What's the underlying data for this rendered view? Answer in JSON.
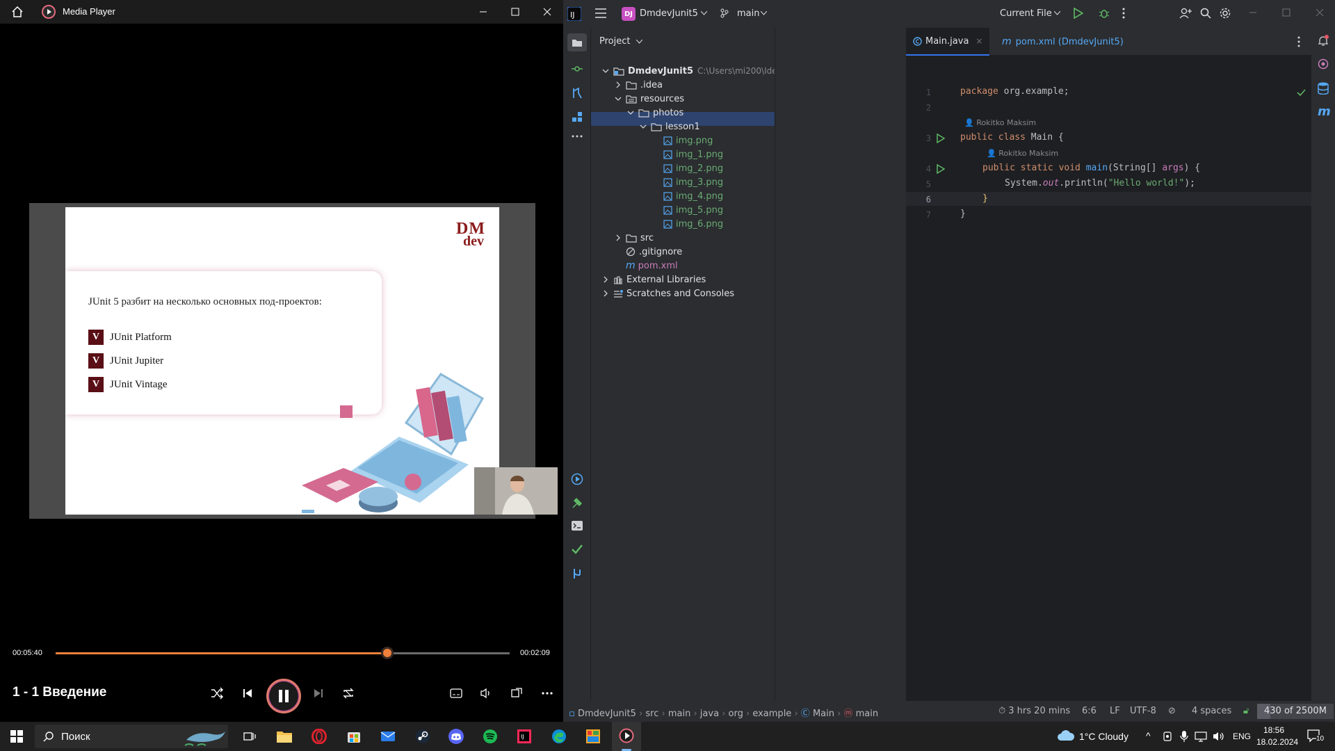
{
  "media_player": {
    "title": "Media Player",
    "current_time": "00:05:40",
    "remaining_time": "00:02:09",
    "progress_fraction": 0.73,
    "now_playing": "1 - 1 Введение",
    "slide": {
      "logo_top": "DM",
      "logo_bottom": "dev",
      "heading": "JUnit 5 разбит на несколько основных под-проектов:",
      "bullet_marker": "V",
      "bullets": [
        "JUnit Platform",
        "JUnit Jupiter",
        "JUnit Vintage"
      ]
    }
  },
  "ide": {
    "project_badge": "DJ",
    "project_name": "DmdevJunit5",
    "branch": "main",
    "run_config": "Current File",
    "panel_title": "Project",
    "tree": {
      "root_name": "DmdevJunit5",
      "root_path": "C:\\Users\\mi200\\IdeaProjects\\DmdevJunit5",
      "idea": ".idea",
      "resources": "resources",
      "photos": "photos",
      "lesson1": "lesson1",
      "files": [
        "img.png",
        "img_1.png",
        "img_2.png",
        "img_3.png",
        "img_4.png",
        "img_5.png",
        "img_6.png"
      ],
      "src": "src",
      "gitignore": ".gitignore",
      "pom": "pom.xml",
      "external": "External Libraries",
      "scratches": "Scratches and Consoles"
    },
    "tabs": [
      "Main.java",
      "pom.xml (DmdevJunit5)"
    ],
    "line_numbers": [
      "1",
      "2",
      "3",
      "4",
      "5",
      "6",
      "7"
    ],
    "code": {
      "l1_kw": "package",
      "l1_rest": " org.example;",
      "author": "Rokitko Maksim",
      "l3_kw": "public class",
      "l3_rest": " Main {",
      "l4_kw": "public static void",
      "l4_fn": "main",
      "l4_type": "(String[] ",
      "l4_param": "args",
      "l4_end": ") {",
      "l5_obj": "System.",
      "l5_out": "out",
      "l5_call": ".println(",
      "l5_str": "\"Hello world!\"",
      "l5_end": ");",
      "l6": "}",
      "l7": "}"
    },
    "status": {
      "crumbs": [
        "DmdevJunit5",
        "src",
        "main",
        "java",
        "org",
        "example",
        "Main",
        "main"
      ],
      "time_tracked": "3 hrs 20 mins",
      "position": "6:6",
      "line_sep": "LF",
      "encoding": "UTF-8",
      "indent": "4 spaces",
      "memory": "430 of 2500M"
    }
  },
  "taskbar": {
    "search_placeholder": "Поиск",
    "weather": "1°C  Cloudy",
    "lang": "ENG",
    "time": "18:56",
    "date": "18.02.2024",
    "notifications": "10"
  },
  "colors": {
    "accent_orange": "#f0803c",
    "ide_bg": "#1e1f22",
    "ide_panel": "#2b2d30",
    "selection": "#2e436e"
  }
}
